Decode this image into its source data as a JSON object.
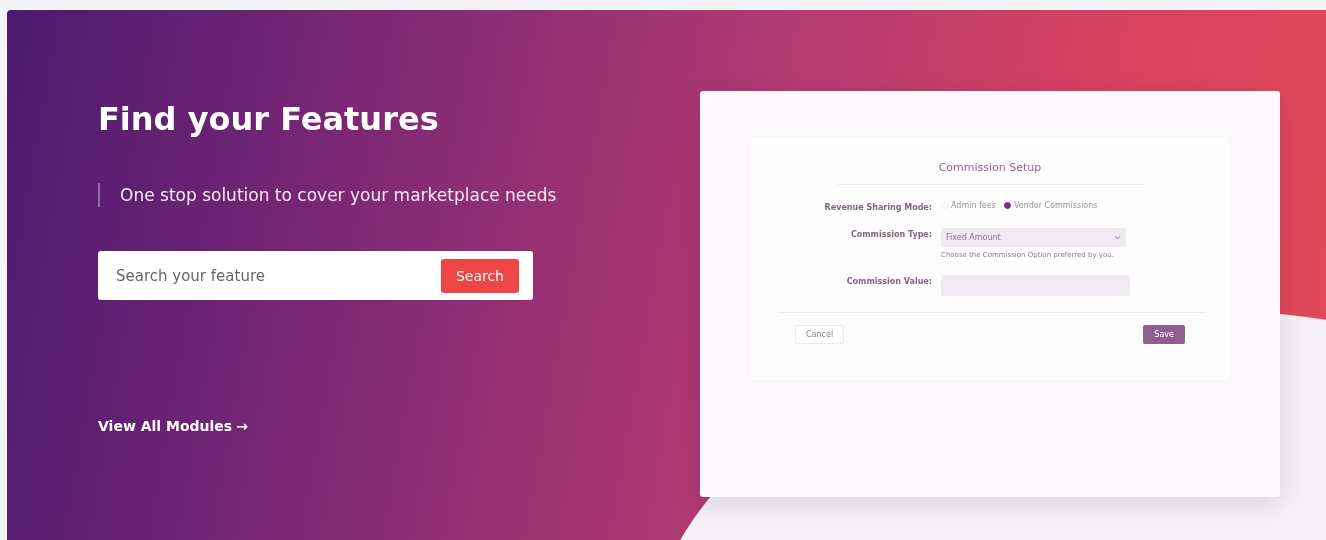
{
  "hero": {
    "title": "Find your Features",
    "subtitle": "One stop solution to cover your marketplace needs",
    "search": {
      "placeholder": "Search your feature",
      "button": "Search"
    },
    "link": {
      "label": "View All Modules",
      "arrow": "→"
    }
  },
  "preview": {
    "title": "Commission Setup",
    "revenue_mode": {
      "label": "Revenue Sharing Mode:",
      "options": [
        {
          "label": "Admin fees",
          "selected": false
        },
        {
          "label": "Vendor Commissions",
          "selected": true
        }
      ]
    },
    "commission_type": {
      "label": "Commission Type:",
      "value": "Fixed Amount",
      "hint": "Choose the Commission Option preferred by you."
    },
    "commission_value": {
      "label": "Commission Value:"
    },
    "buttons": {
      "cancel": "Cancel",
      "save": "Save"
    }
  }
}
